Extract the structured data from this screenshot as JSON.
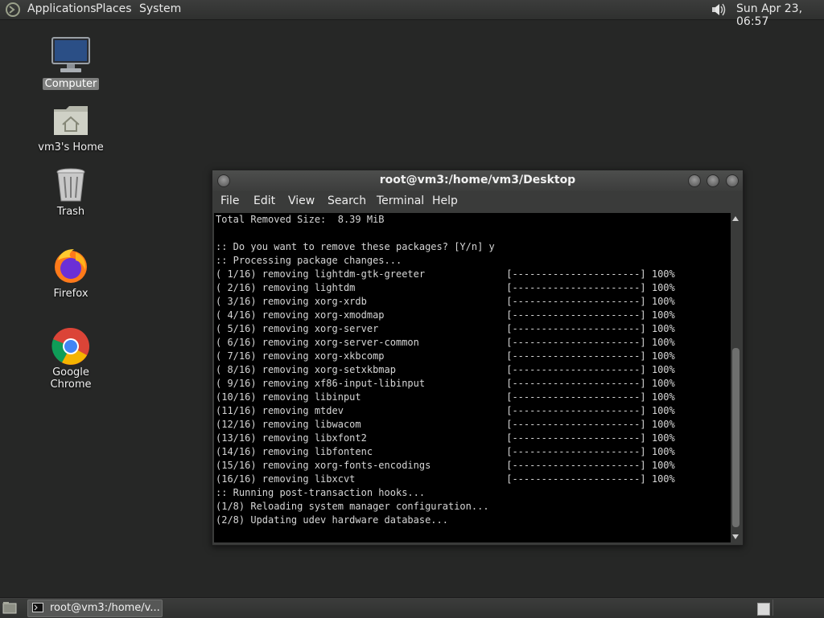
{
  "top_panel": {
    "menus": [
      "Applications",
      "Places",
      "System"
    ],
    "clock": "Sun Apr 23, 06:57"
  },
  "desktop_icons": [
    {
      "label": "Computer"
    },
    {
      "label": "vm3's Home"
    },
    {
      "label": "Trash"
    },
    {
      "label": "Firefox"
    },
    {
      "label": "Google Chrome"
    }
  ],
  "terminal": {
    "title": "root@vm3:/home/vm3/Desktop",
    "menus": [
      "File",
      "Edit",
      "View",
      "Search",
      "Terminal",
      "Help"
    ],
    "lines": [
      "Total Removed Size:  8.39 MiB",
      "",
      ":: Do you want to remove these packages? [Y/n] y",
      ":: Processing package changes...",
      "( 1/16) removing lightdm-gtk-greeter              [----------------------] 100%",
      "( 2/16) removing lightdm                          [----------------------] 100%",
      "( 3/16) removing xorg-xrdb                        [----------------------] 100%",
      "( 4/16) removing xorg-xmodmap                     [----------------------] 100%",
      "( 5/16) removing xorg-server                      [----------------------] 100%",
      "( 6/16) removing xorg-server-common               [----------------------] 100%",
      "( 7/16) removing xorg-xkbcomp                     [----------------------] 100%",
      "( 8/16) removing xorg-setxkbmap                   [----------------------] 100%",
      "( 9/16) removing xf86-input-libinput              [----------------------] 100%",
      "(10/16) removing libinput                         [----------------------] 100%",
      "(11/16) removing mtdev                            [----------------------] 100%",
      "(12/16) removing libwacom                         [----------------------] 100%",
      "(13/16) removing libxfont2                        [----------------------] 100%",
      "(14/16) removing libfontenc                       [----------------------] 100%",
      "(15/16) removing xorg-fonts-encodings             [----------------------] 100%",
      "(16/16) removing libxcvt                          [----------------------] 100%",
      ":: Running post-transaction hooks...",
      "(1/8) Reloading system manager configuration...",
      "(2/8) Updating udev hardware database..."
    ]
  },
  "taskbar": {
    "window_label": "root@vm3:/home/v..."
  },
  "colors": {
    "desktop_bg": "#262726",
    "panel_bg": "#363736",
    "terminal_bg": "#000000",
    "terminal_fg": "#d6d6d6"
  }
}
